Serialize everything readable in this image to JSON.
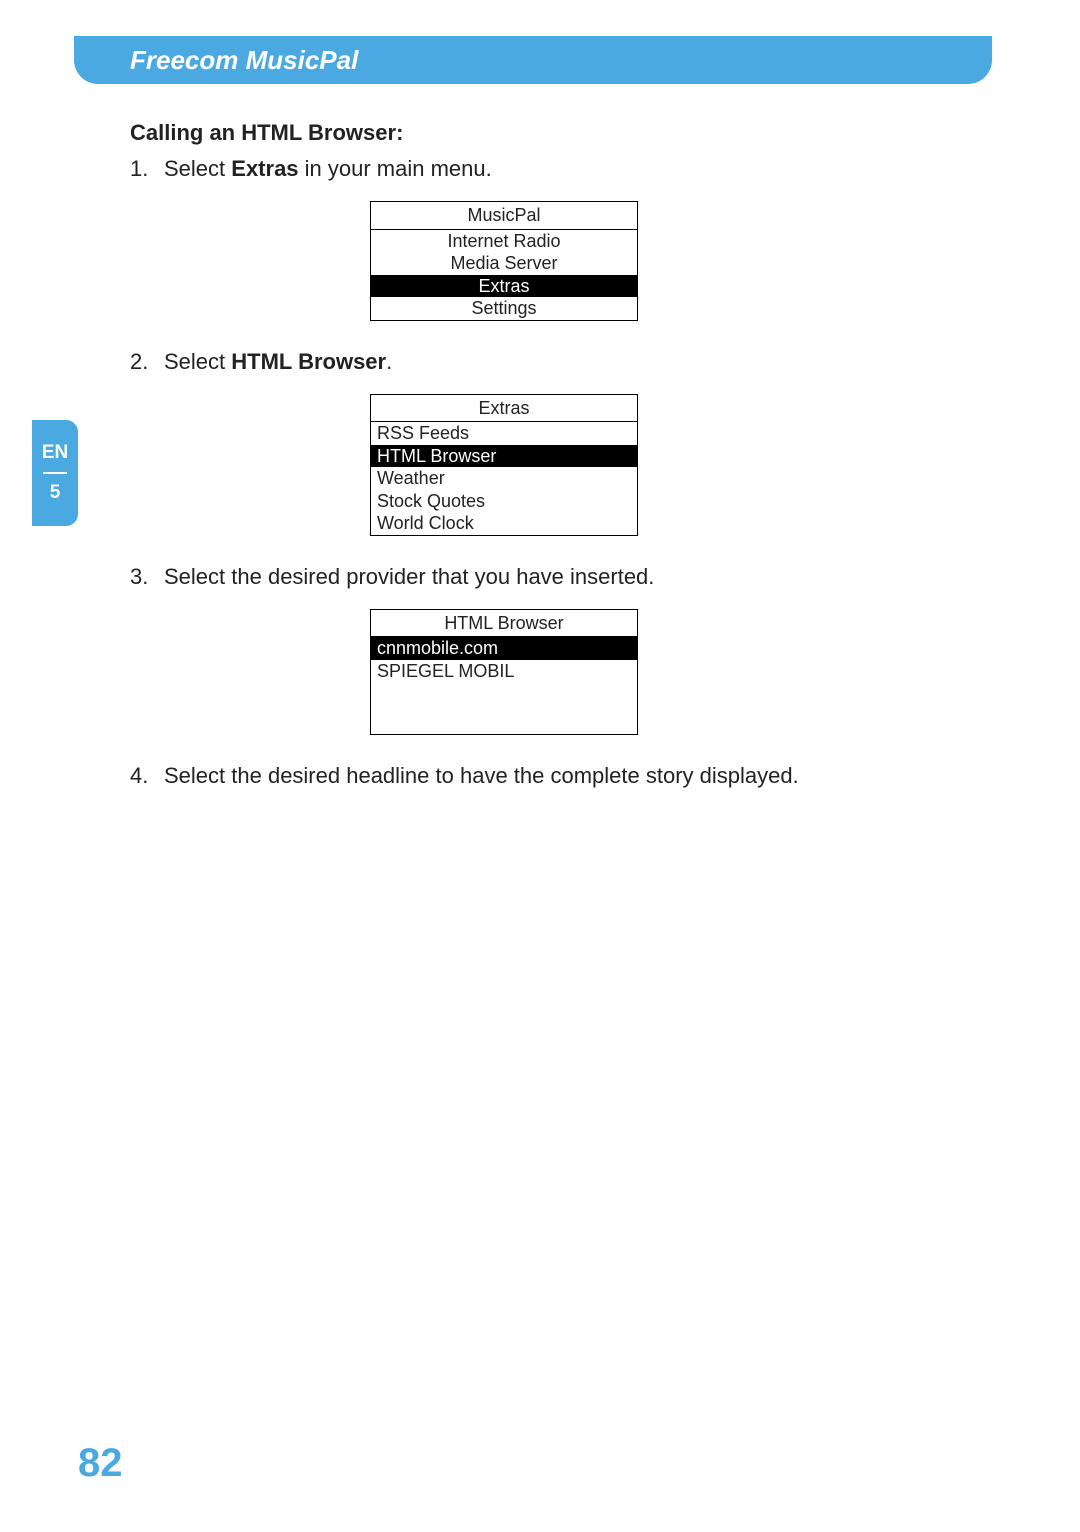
{
  "header": {
    "title": "Freecom MusicPal"
  },
  "sideTab": {
    "lang": "EN",
    "chapter": "5"
  },
  "pageNumber": "82",
  "section": {
    "title": "Calling an HTML Browser:"
  },
  "steps": {
    "s1": {
      "num": "1.",
      "pre": "Select ",
      "bold": "Extras",
      "post": " in your main menu."
    },
    "s2": {
      "num": "2.",
      "pre": "Select ",
      "bold": "HTML Browser",
      "post": "."
    },
    "s3": {
      "num": "3.",
      "text": "Select the desired provider that you have inserted."
    },
    "s4": {
      "num": "4.",
      "text": "Select the desired headline to have the complete story displayed."
    }
  },
  "menu1": {
    "title": "MusicPal",
    "items": {
      "i0": "Internet Radio",
      "i1": "Media Server",
      "i2": "Extras",
      "i3": "Settings"
    }
  },
  "menu2": {
    "title": "Extras",
    "items": {
      "i0": "RSS Feeds",
      "i1": "HTML Browser",
      "i2": "Weather",
      "i3": "Stock Quotes",
      "i4": "World Clock"
    }
  },
  "menu3": {
    "title": "HTML Browser",
    "items": {
      "i0": "cnnmobile.com",
      "i1": "SPIEGEL MOBIL"
    }
  }
}
